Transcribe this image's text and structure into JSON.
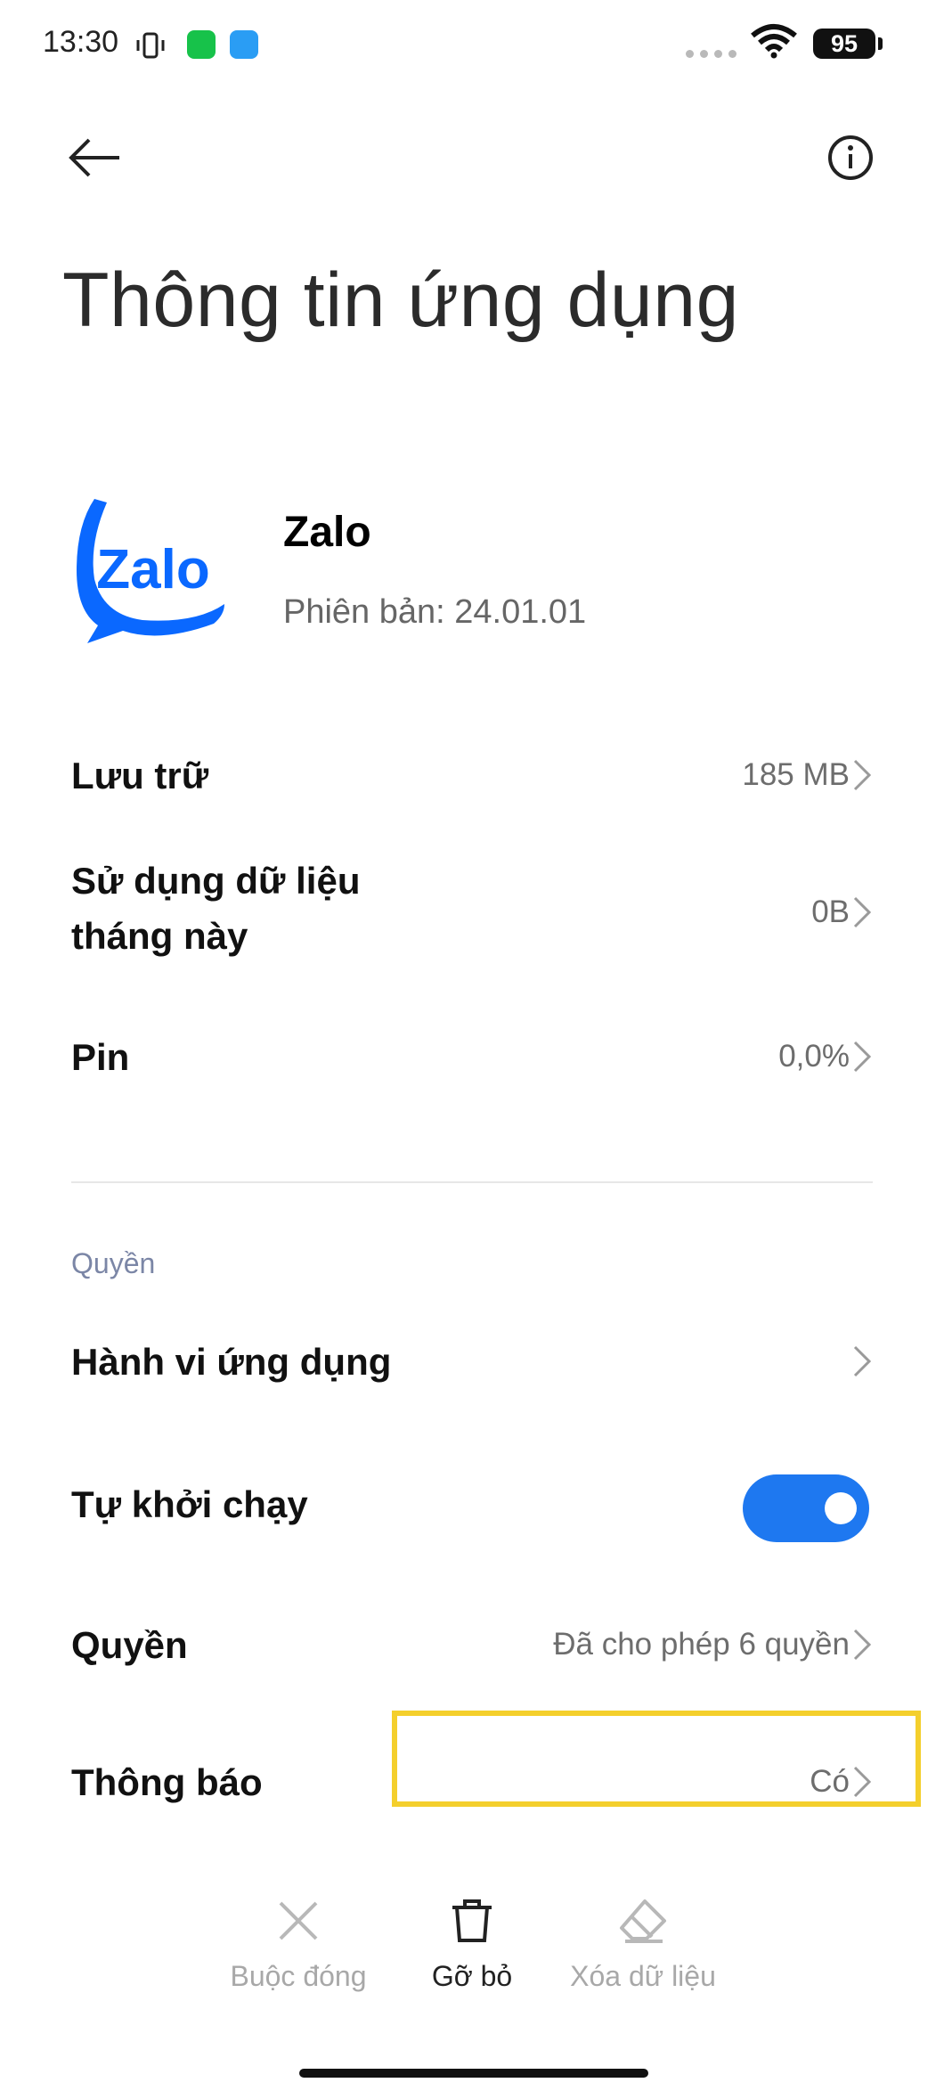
{
  "status_bar": {
    "time": "13:30",
    "battery": "95"
  },
  "header": {
    "back_icon": "arrow-left-icon",
    "info_icon": "info-circle-icon",
    "title": "Thông tin ứng dụng"
  },
  "app": {
    "name": "Zalo",
    "version": "Phiên bản: 24.01.01",
    "logo_text": "Zalo",
    "logo_color": "#0068ff"
  },
  "rows": {
    "storage": {
      "label": "Lưu trữ",
      "value": "185 MB"
    },
    "data_usage": {
      "label_line1": "Sử dụng dữ liệu",
      "label_line2": "tháng này",
      "value": "0B"
    },
    "battery": {
      "label": "Pin",
      "value": "0,0%"
    },
    "section_permissions": "Quyền",
    "app_behavior": {
      "label": "Hành vi ứng dụng"
    },
    "autostart": {
      "label": "Tự khởi chạy",
      "enabled": true
    },
    "permissions": {
      "label": "Quyền",
      "value": "Đã cho phép 6 quyền"
    },
    "notifications": {
      "label": "Thông báo",
      "value": "Có"
    }
  },
  "actions": {
    "force_stop": {
      "label": "Buộc đóng",
      "enabled": false
    },
    "uninstall": {
      "label": "Gỡ bỏ",
      "enabled": true
    },
    "clear_data": {
      "label": "Xóa dữ liệu",
      "enabled": false
    }
  },
  "colors": {
    "accent": "#1e78f0",
    "highlight": "#f4cf2c",
    "section_label": "#7b86a6"
  }
}
